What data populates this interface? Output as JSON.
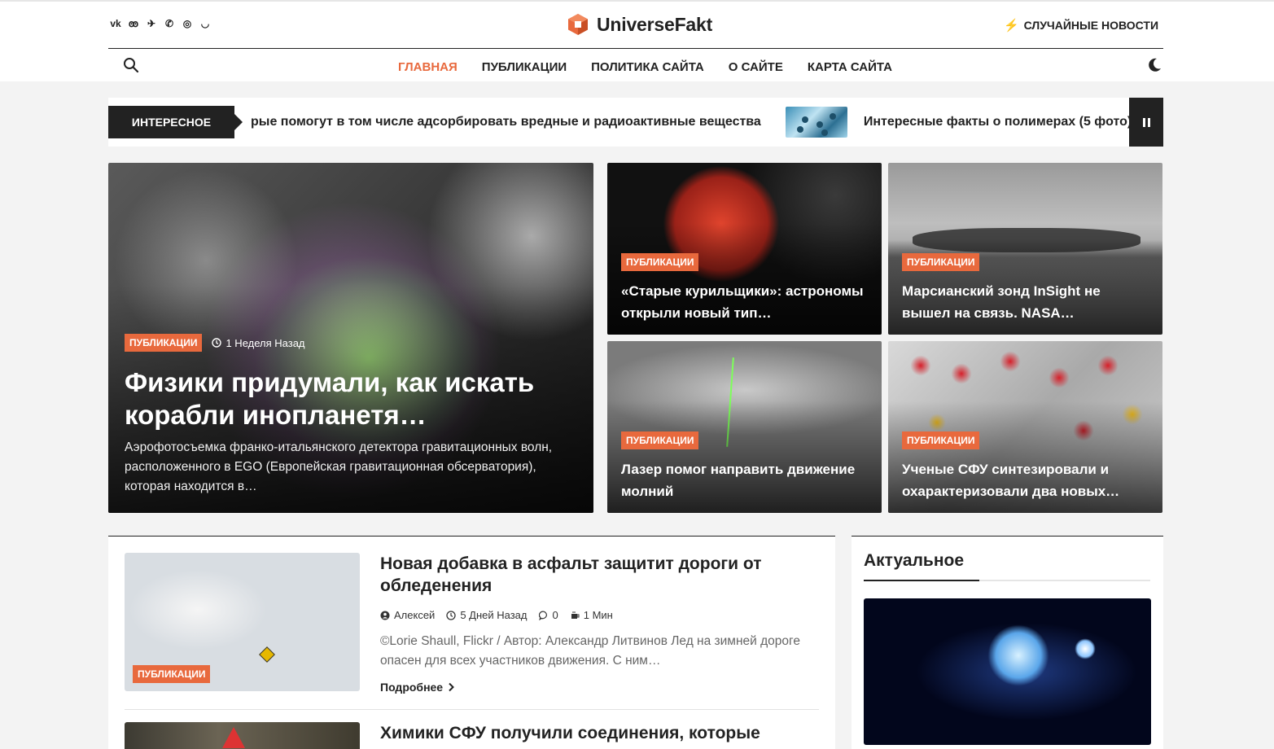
{
  "header": {
    "social": [
      "vk",
      "ok",
      "telegram",
      "viber",
      "whatsapp",
      "messenger"
    ],
    "social_glyphs": [
      "vk",
      "ꙭ",
      "✈",
      "✆",
      "◎",
      "◡"
    ],
    "logo": "UniverseFakt",
    "random_news": "СЛУЧАЙНЫЕ НОВОСТИ",
    "brand_color": "#e8693d"
  },
  "nav": [
    {
      "label": "ГЛАВНАЯ",
      "active": true
    },
    {
      "label": "ПУБЛИКАЦИИ"
    },
    {
      "label": "ПОЛИТИКА САЙТА"
    },
    {
      "label": "О САЙТЕ"
    },
    {
      "label": "КАРТА САЙТА"
    }
  ],
  "ticker": {
    "label": "ИНТЕРЕСНОЕ",
    "item1": "рые помогут в том числе адсорбировать вредные и радиоактивные вещества",
    "item2": "Интересные факты о полимерах (5 фото)"
  },
  "hero": {
    "main": {
      "category": "ПУБЛИКАЦИИ",
      "time": "1 Неделя Назад",
      "title": "Физики придумали, как искать корабли инопланетя…",
      "excerpt": "Аэрофотосъемка франко-итальянского детектора гравитационных волн, расположенного в EGO (Европейская гравитационная обсерватория), которая находится в…"
    },
    "cards": [
      {
        "category": "ПУБЛИКАЦИИ",
        "title": "«Старые курильщики»: астрономы открыли новый тип…"
      },
      {
        "category": "ПУБЛИКАЦИИ",
        "title": "Марсианский зонд InSight не вышел на связь. NASA…"
      },
      {
        "category": "ПУБЛИКАЦИИ",
        "title": "Лазер помог направить движение молний"
      },
      {
        "category": "ПУБЛИКАЦИИ",
        "title": "Ученые СФУ синтезировали и охарактеризовали два новых…"
      }
    ]
  },
  "posts": [
    {
      "category": "ПУБЛИКАЦИИ",
      "title": "Новая добавка в асфальт защитит дороги от обледенения",
      "author": "Алексей",
      "date": "5 Дней Назад",
      "comments": "0",
      "read_time": "1 Мин",
      "excerpt": "©Lorie Shaull, Flickr / Автор: Александр Литвинов Лед на зимней дороге опасен для всех участников движения. С ним…",
      "read_more": "Подробнее"
    },
    {
      "title": "Химики СФУ получили соединения, которые"
    }
  ],
  "sidebar": {
    "title": "Актуальное"
  }
}
